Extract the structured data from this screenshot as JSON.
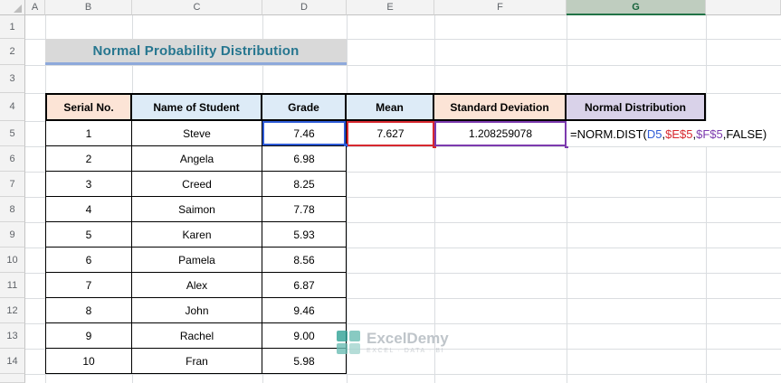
{
  "sheet": {
    "column_headers": [
      "A",
      "B",
      "C",
      "D",
      "E",
      "F",
      "G"
    ],
    "row_headers": [
      "1",
      "2",
      "3",
      "4",
      "5",
      "6",
      "7",
      "8",
      "9",
      "10",
      "11",
      "12",
      "13",
      "14"
    ],
    "active_column": "G"
  },
  "title": "Normal Probability Distribution",
  "table": {
    "headers": [
      "Serial No.",
      "Name of Student",
      "Grade",
      "Mean",
      "Standard Deviation",
      "Normal Distribution"
    ],
    "rows": [
      {
        "serial": "1",
        "name": "Steve",
        "grade": "7.46"
      },
      {
        "serial": "2",
        "name": "Angela",
        "grade": "6.98"
      },
      {
        "serial": "3",
        "name": "Creed",
        "grade": "8.25"
      },
      {
        "serial": "4",
        "name": "Saimon",
        "grade": "7.78"
      },
      {
        "serial": "5",
        "name": "Karen",
        "grade": "5.93"
      },
      {
        "serial": "6",
        "name": "Pamela",
        "grade": "8.56"
      },
      {
        "serial": "7",
        "name": "Alex",
        "grade": "6.87"
      },
      {
        "serial": "8",
        "name": "John",
        "grade": "9.46"
      },
      {
        "serial": "9",
        "name": "Rachel",
        "grade": "9.00"
      },
      {
        "serial": "10",
        "name": "Fran",
        "grade": "5.98"
      }
    ],
    "mean": "7.627",
    "std_dev": "1.208259078"
  },
  "formula": {
    "segments": [
      {
        "text": "=NORM.DIST(",
        "color": "#000000"
      },
      {
        "text": "D5",
        "color": "#2E5BD7"
      },
      {
        "text": ",",
        "color": "#000000"
      },
      {
        "text": "$E$5",
        "color": "#D7282F"
      },
      {
        "text": ",",
        "color": "#000000"
      },
      {
        "text": "$F$5",
        "color": "#7C3AAE"
      },
      {
        "text": ",FALSE)",
        "color": "#000000"
      }
    ]
  },
  "colors": {
    "ref_blue": "#2E5BD7",
    "ref_red": "#D7282F",
    "ref_purple": "#7C3AAE",
    "excel_green": "#217346",
    "title_color": "#26768F",
    "title_bg": "#D9D9D9",
    "title_underline": "#8EA9DB",
    "header_serial_bg": "#FCE4D6",
    "header_name_bg": "#DDEBF7",
    "header_grade_bg": "#DDEBF7",
    "header_mean_bg": "#DDEBF7",
    "header_std_bg": "#FCE4D6",
    "header_normal_bg": "#D9D2E9"
  },
  "watermark": {
    "brand": "ExcelDemy",
    "tagline": "EXCEL · DATA · BI"
  }
}
